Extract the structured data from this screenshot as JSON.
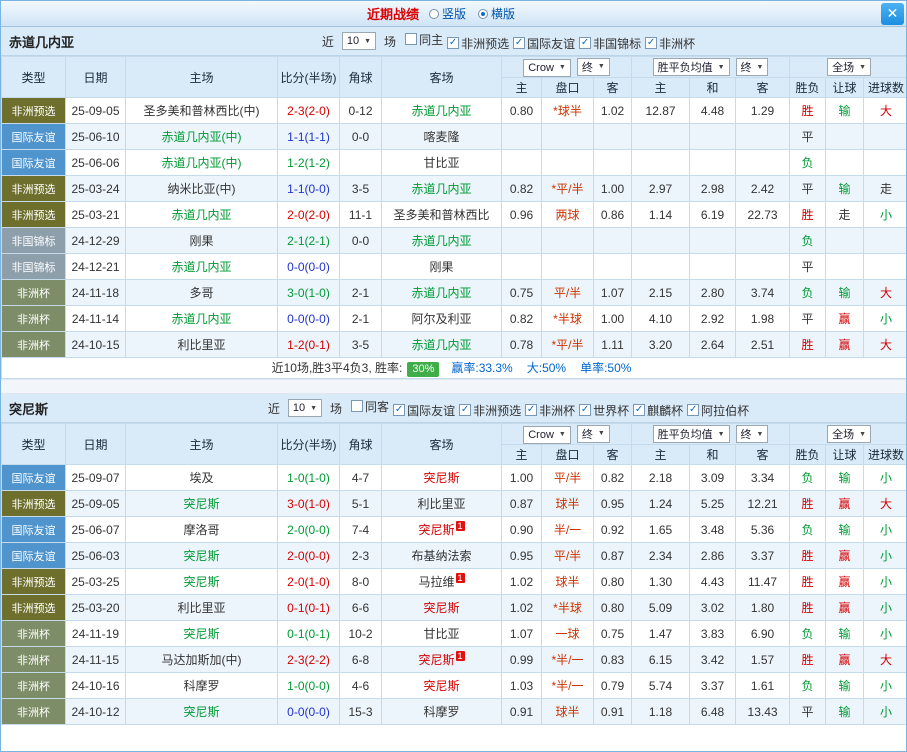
{
  "titlebar": {
    "title": "近期战绩",
    "layout_options": [
      {
        "label": "竖版",
        "selected": false
      },
      {
        "label": "横版",
        "selected": true
      }
    ]
  },
  "icons": {
    "chevron_down": "▼",
    "check": "✓",
    "close": "✕"
  },
  "table_header": {
    "main_columns": [
      "类型",
      "日期",
      "主场",
      "比分(半场)",
      "角球",
      "客场"
    ],
    "sub_columns": [
      "主",
      "盘口",
      "客",
      "主",
      "和",
      "客",
      "胜负",
      "让球",
      "进球数"
    ],
    "dropdown_groups": [
      [
        "Crow",
        "终"
      ],
      [
        "胜平负均值",
        "终"
      ],
      [
        "全场"
      ]
    ]
  },
  "token_colors": {
    "red": "#d40000",
    "green": "#009933",
    "blue": "#2233cc",
    "black": "#333333"
  },
  "colors": {
    "handicap_line_red": "#cc3300",
    "badge_green": "#3fae49",
    "stat_blue": "#0066cc",
    "title_red": "#dd0000",
    "header_blue": "#d9eaf8"
  },
  "type_colors": {
    "非洲预选": "#6f6f2d",
    "国际友谊": "#4f94cd",
    "非国锦标": "#8e9fac",
    "非洲杯": "#7d8d68"
  },
  "sections": [
    {
      "team": "赤道几内亚",
      "filter": {
        "near": "近",
        "count": "10",
        "matches": "场",
        "checkboxes": [
          {
            "label": "同主",
            "checked": false
          },
          {
            "label": "非洲预选",
            "checked": true
          },
          {
            "label": "国际友谊",
            "checked": true
          },
          {
            "label": "非国锦标",
            "checked": true
          },
          {
            "label": "非洲杯",
            "checked": true
          }
        ]
      },
      "rows": [
        {
          "type": "非洲预选",
          "date": "25-09-05",
          "home": {
            "name": "圣多美和普林西比(中)",
            "color": "black",
            "red_cards": 0
          },
          "score": "2-3(2-0)",
          "score_color": "red",
          "corners": "0-12",
          "away": {
            "name": "赤道几内亚",
            "color": "green",
            "red_cards": 0
          },
          "asian_home": "0.80",
          "asian_line": "*球半",
          "asian_away": "1.02",
          "euro_home": "12.87",
          "euro_draw": "4.48",
          "euro_away": "1.29",
          "result": "胜",
          "result_color": "red",
          "handicap": "输",
          "handicap_color": "green",
          "goals": "大",
          "goals_color": "red"
        },
        {
          "type": "国际友谊",
          "date": "25-06-10",
          "home": {
            "name": "赤道几内亚(中)",
            "color": "green",
            "red_cards": 0
          },
          "score": "1-1(1-1)",
          "score_color": "blue",
          "corners": "0-0",
          "away": {
            "name": "喀麦隆",
            "color": "black",
            "red_cards": 0
          },
          "asian_home": "",
          "asian_line": "",
          "asian_away": "",
          "euro_home": "",
          "euro_draw": "",
          "euro_away": "",
          "result": "平",
          "result_color": "black",
          "handicap": "",
          "handicap_color": "black",
          "goals": "",
          "goals_color": "black"
        },
        {
          "type": "国际友谊",
          "date": "25-06-06",
          "home": {
            "name": "赤道几内亚(中)",
            "color": "green",
            "red_cards": 0
          },
          "score": "1-2(1-2)",
          "score_color": "green",
          "corners": "",
          "away": {
            "name": "甘比亚",
            "color": "black",
            "red_cards": 0
          },
          "asian_home": "",
          "asian_line": "",
          "asian_away": "",
          "euro_home": "",
          "euro_draw": "",
          "euro_away": "",
          "result": "负",
          "result_color": "green",
          "handicap": "",
          "handicap_color": "black",
          "goals": "",
          "goals_color": "black"
        },
        {
          "type": "非洲预选",
          "date": "25-03-24",
          "home": {
            "name": "纳米比亚(中)",
            "color": "black",
            "red_cards": 0
          },
          "score": "1-1(0-0)",
          "score_color": "blue",
          "corners": "3-5",
          "away": {
            "name": "赤道几内亚",
            "color": "green",
            "red_cards": 0
          },
          "asian_home": "0.82",
          "asian_line": "*平/半",
          "asian_away": "1.00",
          "euro_home": "2.97",
          "euro_draw": "2.98",
          "euro_away": "2.42",
          "result": "平",
          "result_color": "black",
          "handicap": "输",
          "handicap_color": "green",
          "goals": "走",
          "goals_color": "black"
        },
        {
          "type": "非洲预选",
          "date": "25-03-21",
          "home": {
            "name": "赤道几内亚",
            "color": "green",
            "red_cards": 0
          },
          "score": "2-0(2-0)",
          "score_color": "red",
          "corners": "11-1",
          "away": {
            "name": "圣多美和普林西比",
            "color": "black",
            "red_cards": 0
          },
          "asian_home": "0.96",
          "asian_line": "两球",
          "asian_away": "0.86",
          "euro_home": "1.14",
          "euro_draw": "6.19",
          "euro_away": "22.73",
          "result": "胜",
          "result_color": "red",
          "handicap": "走",
          "handicap_color": "black",
          "goals": "小",
          "goals_color": "green"
        },
        {
          "type": "非国锦标",
          "date": "24-12-29",
          "home": {
            "name": "刚果",
            "color": "black",
            "red_cards": 0
          },
          "score": "2-1(2-1)",
          "score_color": "green",
          "corners": "0-0",
          "away": {
            "name": "赤道几内亚",
            "color": "green",
            "red_cards": 0
          },
          "asian_home": "",
          "asian_line": "",
          "asian_away": "",
          "euro_home": "",
          "euro_draw": "",
          "euro_away": "",
          "result": "负",
          "result_color": "green",
          "handicap": "",
          "handicap_color": "black",
          "goals": "",
          "goals_color": "black"
        },
        {
          "type": "非国锦标",
          "date": "24-12-21",
          "home": {
            "name": "赤道几内亚",
            "color": "green",
            "red_cards": 0
          },
          "score": "0-0(0-0)",
          "score_color": "blue",
          "corners": "",
          "away": {
            "name": "刚果",
            "color": "black",
            "red_cards": 0
          },
          "asian_home": "",
          "asian_line": "",
          "asian_away": "",
          "euro_home": "",
          "euro_draw": "",
          "euro_away": "",
          "result": "平",
          "result_color": "black",
          "handicap": "",
          "handicap_color": "black",
          "goals": "",
          "goals_color": "black"
        },
        {
          "type": "非洲杯",
          "date": "24-11-18",
          "home": {
            "name": "多哥",
            "color": "black",
            "red_cards": 0
          },
          "score": "3-0(1-0)",
          "score_color": "green",
          "corners": "2-1",
          "away": {
            "name": "赤道几内亚",
            "color": "green",
            "red_cards": 0
          },
          "asian_home": "0.75",
          "asian_line": "平/半",
          "asian_away": "1.07",
          "euro_home": "2.15",
          "euro_draw": "2.80",
          "euro_away": "3.74",
          "result": "负",
          "result_color": "green",
          "handicap": "输",
          "handicap_color": "green",
          "goals": "大",
          "goals_color": "red"
        },
        {
          "type": "非洲杯",
          "date": "24-11-14",
          "home": {
            "name": "赤道几内亚",
            "color": "green",
            "red_cards": 0
          },
          "score": "0-0(0-0)",
          "score_color": "blue",
          "corners": "2-1",
          "away": {
            "name": "阿尔及利亚",
            "color": "black",
            "red_cards": 0
          },
          "asian_home": "0.82",
          "asian_line": "*半球",
          "asian_away": "1.00",
          "euro_home": "4.10",
          "euro_draw": "2.92",
          "euro_away": "1.98",
          "result": "平",
          "result_color": "black",
          "handicap": "赢",
          "handicap_color": "red",
          "goals": "小",
          "goals_color": "green"
        },
        {
          "type": "非洲杯",
          "date": "24-10-15",
          "home": {
            "name": "利比里亚",
            "color": "black",
            "red_cards": 0
          },
          "score": "1-2(0-1)",
          "score_color": "red",
          "corners": "3-5",
          "away": {
            "name": "赤道几内亚",
            "color": "green",
            "red_cards": 0
          },
          "asian_home": "0.78",
          "asian_line": "*平/半",
          "asian_away": "1.11",
          "euro_home": "3.20",
          "euro_draw": "2.64",
          "euro_away": "2.51",
          "result": "胜",
          "result_color": "red",
          "handicap": "赢",
          "handicap_color": "red",
          "goals": "大",
          "goals_color": "red"
        }
      ],
      "summary": {
        "lead": "近10场,胜3平4负3, 胜率:",
        "win_rate_badge": "30%",
        "stats": [
          "赢率:33.3%",
          "大:50%",
          "单率:50%"
        ]
      }
    },
    {
      "team": "突尼斯",
      "filter": {
        "near": "近",
        "count": "10",
        "matches": "场",
        "checkboxes": [
          {
            "label": "同客",
            "checked": false
          },
          {
            "label": "国际友谊",
            "checked": true
          },
          {
            "label": "非洲预选",
            "checked": true
          },
          {
            "label": "非洲杯",
            "checked": true
          },
          {
            "label": "世界杯",
            "checked": true
          },
          {
            "label": "麒麟杯",
            "checked": true
          },
          {
            "label": "阿拉伯杯",
            "checked": true
          }
        ]
      },
      "rows": [
        {
          "type": "国际友谊",
          "date": "25-09-07",
          "home": {
            "name": "埃及",
            "color": "black",
            "red_cards": 0
          },
          "score": "1-0(1-0)",
          "score_color": "green",
          "corners": "4-7",
          "away": {
            "name": "突尼斯",
            "color": "red",
            "red_cards": 0
          },
          "asian_home": "1.00",
          "asian_line": "平/半",
          "asian_away": "0.82",
          "euro_home": "2.18",
          "euro_draw": "3.09",
          "euro_away": "3.34",
          "result": "负",
          "result_color": "green",
          "handicap": "输",
          "handicap_color": "green",
          "goals": "小",
          "goals_color": "green"
        },
        {
          "type": "非洲预选",
          "date": "25-09-05",
          "home": {
            "name": "突尼斯",
            "color": "green",
            "red_cards": 0
          },
          "score": "3-0(1-0)",
          "score_color": "red",
          "corners": "5-1",
          "away": {
            "name": "利比里亚",
            "color": "black",
            "red_cards": 0
          },
          "asian_home": "0.87",
          "asian_line": "球半",
          "asian_away": "0.95",
          "euro_home": "1.24",
          "euro_draw": "5.25",
          "euro_away": "12.21",
          "result": "胜",
          "result_color": "red",
          "handicap": "赢",
          "handicap_color": "red",
          "goals": "大",
          "goals_color": "red"
        },
        {
          "type": "国际友谊",
          "date": "25-06-07",
          "home": {
            "name": "摩洛哥",
            "color": "black",
            "red_cards": 0
          },
          "score": "2-0(0-0)",
          "score_color": "green",
          "corners": "7-4",
          "away": {
            "name": "突尼斯",
            "color": "red",
            "red_cards": 1
          },
          "asian_home": "0.90",
          "asian_line": "半/一",
          "asian_away": "0.92",
          "euro_home": "1.65",
          "euro_draw": "3.48",
          "euro_away": "5.36",
          "result": "负",
          "result_color": "green",
          "handicap": "输",
          "handicap_color": "green",
          "goals": "小",
          "goals_color": "green"
        },
        {
          "type": "国际友谊",
          "date": "25-06-03",
          "home": {
            "name": "突尼斯",
            "color": "green",
            "red_cards": 0
          },
          "score": "2-0(0-0)",
          "score_color": "red",
          "corners": "2-3",
          "away": {
            "name": "布基纳法索",
            "color": "black",
            "red_cards": 0
          },
          "asian_home": "0.95",
          "asian_line": "平/半",
          "asian_away": "0.87",
          "euro_home": "2.34",
          "euro_draw": "2.86",
          "euro_away": "3.37",
          "result": "胜",
          "result_color": "red",
          "handicap": "赢",
          "handicap_color": "red",
          "goals": "小",
          "goals_color": "green"
        },
        {
          "type": "非洲预选",
          "date": "25-03-25",
          "home": {
            "name": "突尼斯",
            "color": "green",
            "red_cards": 0
          },
          "score": "2-0(1-0)",
          "score_color": "red",
          "corners": "8-0",
          "away": {
            "name": "马拉维",
            "color": "black",
            "red_cards": 1
          },
          "asian_home": "1.02",
          "asian_line": "球半",
          "asian_away": "0.80",
          "euro_home": "1.30",
          "euro_draw": "4.43",
          "euro_away": "11.47",
          "result": "胜",
          "result_color": "red",
          "handicap": "赢",
          "handicap_color": "red",
          "goals": "小",
          "goals_color": "green"
        },
        {
          "type": "非洲预选",
          "date": "25-03-20",
          "home": {
            "name": "利比里亚",
            "color": "black",
            "red_cards": 0
          },
          "score": "0-1(0-1)",
          "score_color": "red",
          "corners": "6-6",
          "away": {
            "name": "突尼斯",
            "color": "red",
            "red_cards": 0
          },
          "asian_home": "1.02",
          "asian_line": "*半球",
          "asian_away": "0.80",
          "euro_home": "5.09",
          "euro_draw": "3.02",
          "euro_away": "1.80",
          "result": "胜",
          "result_color": "red",
          "handicap": "赢",
          "handicap_color": "red",
          "goals": "小",
          "goals_color": "green"
        },
        {
          "type": "非洲杯",
          "date": "24-11-19",
          "home": {
            "name": "突尼斯",
            "color": "green",
            "red_cards": 0
          },
          "score": "0-1(0-1)",
          "score_color": "green",
          "corners": "10-2",
          "away": {
            "name": "甘比亚",
            "color": "black",
            "red_cards": 0
          },
          "asian_home": "1.07",
          "asian_line": "一球",
          "asian_away": "0.75",
          "euro_home": "1.47",
          "euro_draw": "3.83",
          "euro_away": "6.90",
          "result": "负",
          "result_color": "green",
          "handicap": "输",
          "handicap_color": "green",
          "goals": "小",
          "goals_color": "green"
        },
        {
          "type": "非洲杯",
          "date": "24-11-15",
          "home": {
            "name": "马达加斯加(中)",
            "color": "black",
            "red_cards": 0
          },
          "score": "2-3(2-2)",
          "score_color": "red",
          "corners": "6-8",
          "away": {
            "name": "突尼斯",
            "color": "red",
            "red_cards": 1
          },
          "asian_home": "0.99",
          "asian_line": "*半/一",
          "asian_away": "0.83",
          "euro_home": "6.15",
          "euro_draw": "3.42",
          "euro_away": "1.57",
          "result": "胜",
          "result_color": "red",
          "handicap": "赢",
          "handicap_color": "red",
          "goals": "大",
          "goals_color": "red"
        },
        {
          "type": "非洲杯",
          "date": "24-10-16",
          "home": {
            "name": "科摩罗",
            "color": "black",
            "red_cards": 0
          },
          "score": "1-0(0-0)",
          "score_color": "green",
          "corners": "4-6",
          "away": {
            "name": "突尼斯",
            "color": "red",
            "red_cards": 0
          },
          "asian_home": "1.03",
          "asian_line": "*半/一",
          "asian_away": "0.79",
          "euro_home": "5.74",
          "euro_draw": "3.37",
          "euro_away": "1.61",
          "result": "负",
          "result_color": "green",
          "handicap": "输",
          "handicap_color": "green",
          "goals": "小",
          "goals_color": "green"
        },
        {
          "type": "非洲杯",
          "date": "24-10-12",
          "home": {
            "name": "突尼斯",
            "color": "green",
            "red_cards": 0
          },
          "score": "0-0(0-0)",
          "score_color": "blue",
          "corners": "15-3",
          "away": {
            "name": "科摩罗",
            "color": "black",
            "red_cards": 0
          },
          "asian_home": "0.91",
          "asian_line": "球半",
          "asian_away": "0.91",
          "euro_home": "1.18",
          "euro_draw": "6.48",
          "euro_away": "13.43",
          "result": "平",
          "result_color": "black",
          "handicap": "输",
          "handicap_color": "green",
          "goals": "小",
          "goals_color": "green"
        }
      ],
      "summary": null
    }
  ]
}
